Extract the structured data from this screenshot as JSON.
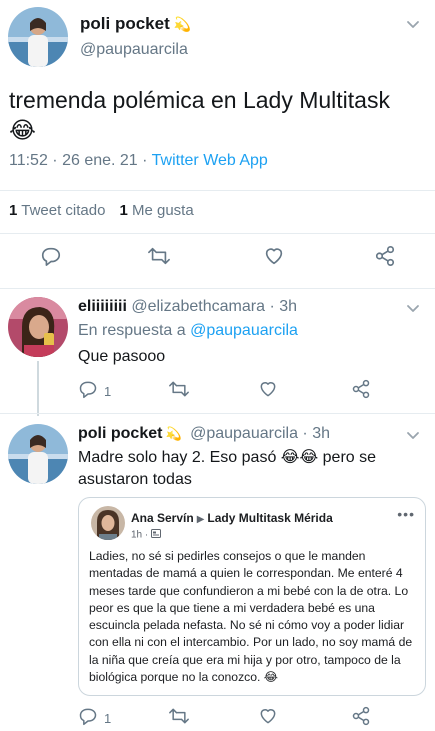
{
  "main_tweet": {
    "display_name": "poli pocket",
    "name_emoji": "💫",
    "handle": "@paupauarcila",
    "text": "tremenda polémica en Lady Multitask",
    "text_emoji": "😂",
    "time": "11:52 · 26 ene. 21 · ",
    "source": "Twitter Web App",
    "quote_count": "1",
    "quote_label": "Tweet citado",
    "like_count": "1",
    "like_label": "Me gusta"
  },
  "reply1": {
    "display_name": "eliiiiiiii",
    "handle": "@elizabethcamara",
    "time": "· 3h",
    "in_reply_label": "En respuesta a",
    "in_reply_handle": "@paupauarcila",
    "text": "Que pasooo",
    "reply_count": "1"
  },
  "reply2": {
    "display_name": "poli pocket",
    "name_emoji": "💫",
    "handle": "@paupauarcila",
    "time": "· 3h",
    "text_a": "Madre solo hay 2. Eso pasó",
    "text_emoji": "😂😂",
    "text_b": "pero se asustaron todas",
    "reply_count": "1",
    "quote": {
      "author": "Ana Servín",
      "arrow": "▶",
      "group": "Lady Multitask Mérida",
      "time": "1h ·",
      "more": "•••",
      "body": "Ladies, no sé si pedirles consejos o que le manden mentadas de mamá a quien le correspondan. Me enteré 4 meses tarde que confundieron a mi bebé con la de otra. Lo peor es que la que tiene a mi verdadera bebé es una escuincla pelada nefasta. No sé ni cómo voy a poder lidiar con ella ni con el intercambio. Por un lado, no soy mamá de la niña que creía que era mi hija y por otro, tampoco de la biológica porque no la conozco. 😂"
    }
  },
  "icons": {
    "reply": "reply-icon",
    "retweet": "retweet-icon",
    "like": "like-icon",
    "share": "share-icon"
  },
  "colors": {
    "link": "#1da1f2",
    "secondary_text": "#657786",
    "primary_text": "#14171a"
  }
}
